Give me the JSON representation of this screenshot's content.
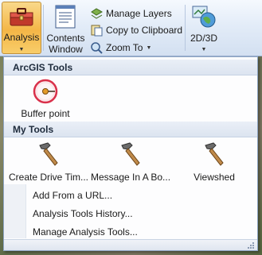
{
  "ribbon": {
    "analysis_label": "Analysis",
    "contents_label_line1": "Contents",
    "contents_label_line2": "Window",
    "manage_layers": "Manage Layers",
    "copy_clipboard": "Copy to Clipboard",
    "zoom_to": "Zoom To",
    "view_2d3d": "2D/3D"
  },
  "menu": {
    "arcgis_header": "ArcGIS Tools",
    "arcgis_tools": [
      {
        "label": "Buffer point",
        "icon": "buffer-point-icon"
      }
    ],
    "my_tools_header": "My Tools",
    "my_tools": [
      {
        "label": "Create Drive Tim...",
        "icon": "hammer-icon"
      },
      {
        "label": "Message In A Bo...",
        "icon": "hammer-icon"
      },
      {
        "label": "Viewshed",
        "icon": "hammer-icon"
      }
    ],
    "items": [
      "Add From a URL...",
      "Analysis Tools History...",
      "Manage Analysis Tools..."
    ]
  },
  "colors": {
    "analysis_highlight": "#f4b647",
    "ribbon_bg": "#e3ecf8",
    "menu_border": "#8ea5c4"
  }
}
